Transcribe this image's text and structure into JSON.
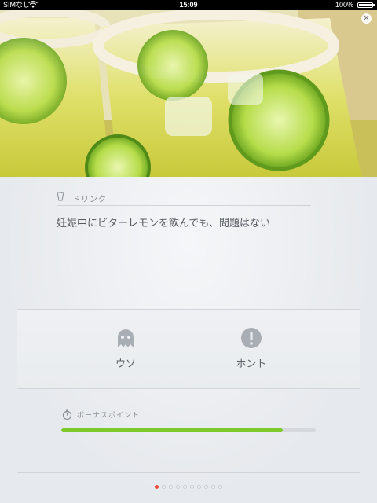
{
  "status_bar": {
    "carrier": "SIMなし",
    "time": "15:09",
    "battery": "100%"
  },
  "hero": {
    "close_icon": "close-icon",
    "image": "lime-drink-photo"
  },
  "quiz": {
    "category_icon": "drink-icon",
    "category": "ドリンク",
    "question": "妊娠中にビターレモンを飲んでも、問題はない",
    "answers": {
      "false_label": "ウソ",
      "false_icon": "ghost-icon",
      "true_label": "ホント",
      "true_icon": "exclamation-icon"
    },
    "bonus": {
      "icon": "stopwatch-icon",
      "label": "ボーナスポイント",
      "progress": 0.87
    },
    "pager": {
      "total": 10,
      "current": 1
    }
  },
  "colors": {
    "progress": "#7ec92a",
    "active_dot": "#e74c3c"
  }
}
